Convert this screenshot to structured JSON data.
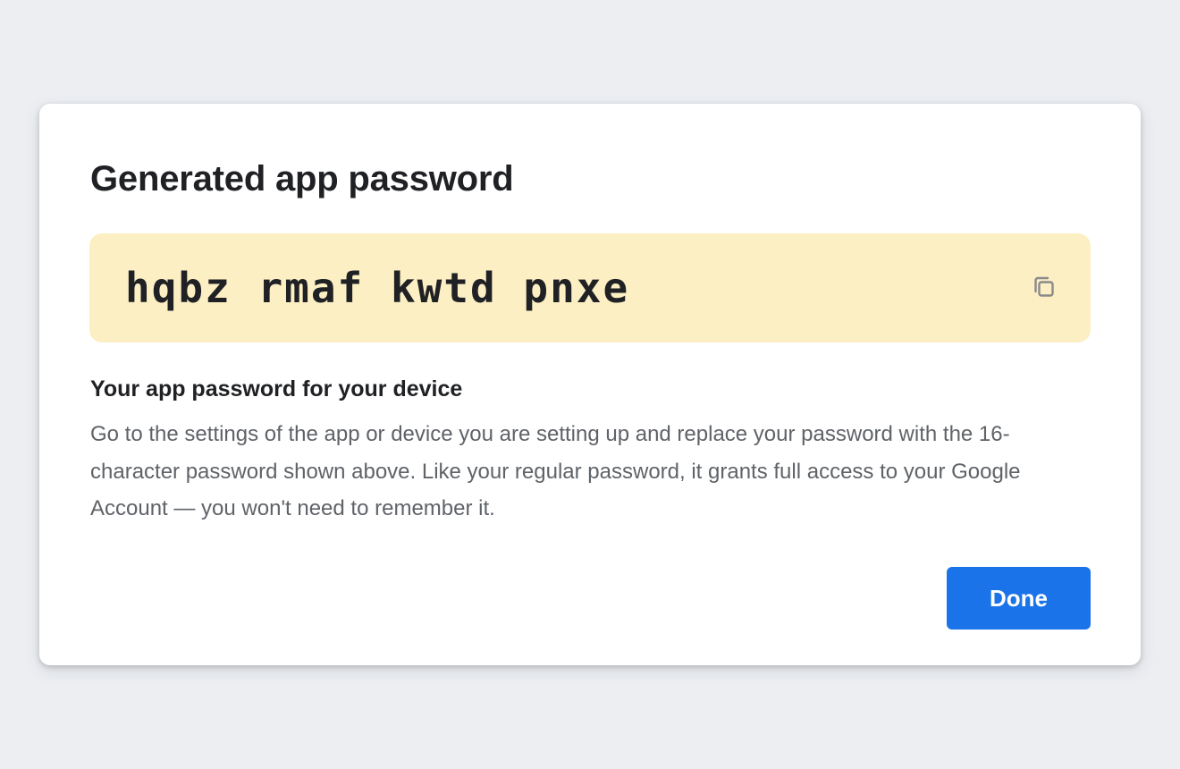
{
  "dialog": {
    "title": "Generated app password",
    "password": "hqbz rmaf kwtd pnxe",
    "copy_icon": "copy-icon",
    "subtitle": "Your app password for your device",
    "description": "Go to the settings of the app or device you are setting up and replace your password with the 16-character password shown above. Like your regular password, it grants full access to your Google Account — you won't need to remember it.",
    "done_label": "Done"
  },
  "colors": {
    "background": "#eceef2",
    "password_box": "#fcefc4",
    "primary_button": "#1a73e8",
    "title_text": "#202124",
    "body_text": "#5f6368"
  }
}
